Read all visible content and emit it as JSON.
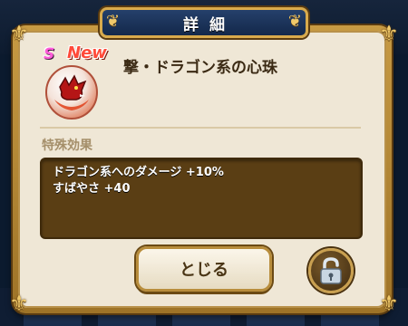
{
  "dialog": {
    "title": "詳細",
    "close_label": "とじる"
  },
  "item": {
    "rank": "S",
    "new_badge": "New",
    "name": "撃・ドラゴン系の心珠",
    "icon": "red-dragon-orb-icon"
  },
  "special_effect": {
    "label": "特殊効果",
    "lines": [
      "ドラゴン系へのダメージ +10%",
      "すばやさ +40"
    ]
  },
  "lock": {
    "icon": "unlocked-padlock-icon",
    "state": "unlocked"
  },
  "colors": {
    "frame_gold": "#c79a43",
    "title_plate": "#25406b",
    "panel_bg": "#efe7d6",
    "effects_bg": "#5a3e14",
    "new_badge": "#ff4a3a",
    "rank_s": "#ff5bd9"
  }
}
